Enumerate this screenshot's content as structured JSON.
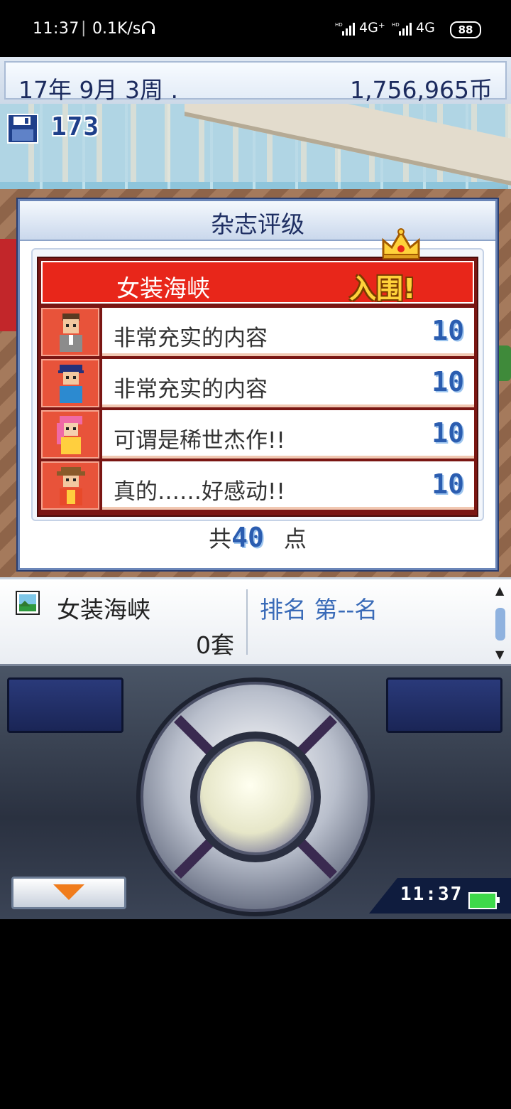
{
  "status_bar": {
    "time": "11:37",
    "separator": "|",
    "net_speed": "0.1K/s",
    "signal1": "4G⁺",
    "signal2": "4G",
    "battery": "88"
  },
  "game_header": {
    "date": "17年 9月 3周 .",
    "money": "1,756,965币"
  },
  "save": {
    "count": "173"
  },
  "modal": {
    "title": "杂志评级",
    "magazine_name": "女装海峡",
    "status": "入围!",
    "reviews": [
      {
        "comment": "非常充实的内容",
        "score": "10",
        "avatar": "reviewer-1"
      },
      {
        "comment": "非常充实的内容",
        "score": "10",
        "avatar": "reviewer-2"
      },
      {
        "comment": "可谓是稀世杰作!!",
        "score": "10",
        "avatar": "reviewer-3"
      },
      {
        "comment": "真的……好感动!!",
        "score": "10",
        "avatar": "reviewer-4"
      }
    ],
    "total_prefix": "共",
    "total_value": "40",
    "total_unit": "点"
  },
  "info_bar": {
    "magazine_name": "女装海峡",
    "sets": "0套",
    "rank": "排名 第--名"
  },
  "controller": {
    "clock": "11:37"
  },
  "colors": {
    "header_red": "#e8261a",
    "status_gold": "#ffd23a",
    "score_blue": "#2b5db0",
    "modal_border": "#6b86b8"
  }
}
